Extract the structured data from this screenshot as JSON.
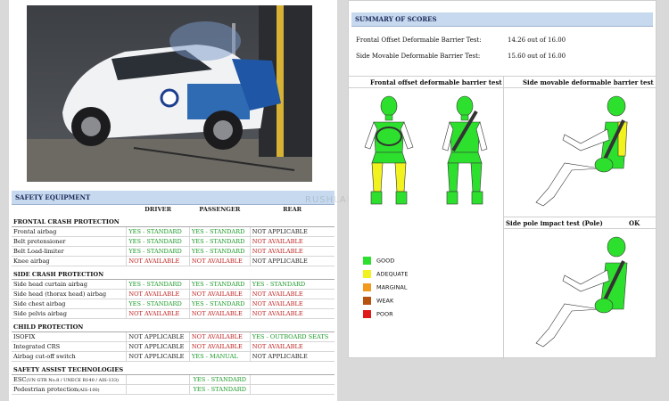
{
  "equipment": {
    "header": "SAFETY EQUIPMENT",
    "columns": [
      "DRIVER",
      "PASSENGER",
      "REAR"
    ],
    "sections": [
      {
        "title": "FRONTAL CRASH PROTECTION",
        "rows": [
          {
            "label": "Frontal airbag",
            "driver": "YES - STANDARD",
            "passenger": "YES - STANDARD",
            "rear": "NOT APPLICABLE"
          },
          {
            "label": "Belt pretensioner",
            "driver": "YES - STANDARD",
            "passenger": "YES - STANDARD",
            "rear": "NOT AVAILABLE"
          },
          {
            "label": "Belt Load-limiter",
            "driver": "YES - STANDARD",
            "passenger": "YES - STANDARD",
            "rear": "NOT AVAILABLE"
          },
          {
            "label": "Knee airbag",
            "driver": "NOT AVAILABLE",
            "passenger": "NOT AVAILABLE",
            "rear": "NOT APPLICABLE"
          }
        ]
      },
      {
        "title": "SIDE CRASH PROTECTION",
        "rows": [
          {
            "label": "Side head curtain airbag",
            "driver": "YES - STANDARD",
            "passenger": "YES - STANDARD",
            "rear": "YES - STANDARD"
          },
          {
            "label": "Side head (thorax head) airbag",
            "driver": "NOT AVAILABLE",
            "passenger": "NOT AVAILABLE",
            "rear": "NOT AVAILABLE"
          },
          {
            "label": "Side chest airbag",
            "driver": "YES - STANDARD",
            "passenger": "YES - STANDARD",
            "rear": "NOT AVAILABLE"
          },
          {
            "label": "Side pelvis airbag",
            "driver": "NOT AVAILABLE",
            "passenger": "NOT AVAILABLE",
            "rear": "NOT AVAILABLE"
          }
        ]
      },
      {
        "title": "CHILD PROTECTION",
        "rows": [
          {
            "label": "ISOFIX",
            "driver": "NOT APPLICABLE",
            "passenger": "NOT AVAILABLE",
            "rear": "YES - OUTBOARD SEATS"
          },
          {
            "label": "Integrated CRS",
            "driver": "NOT APPLICABLE",
            "passenger": "NOT AVAILABLE",
            "rear": "NOT AVAILABLE"
          },
          {
            "label": "Airbag cut-off switch",
            "driver": "NOT APPLICABLE",
            "passenger": "YES - MANUAL",
            "rear": "NOT APPLICABLE"
          }
        ]
      },
      {
        "title": "SAFETY ASSIST TECHNOLOGIES",
        "rows": [
          {
            "label": "ESC",
            "label_small": "(UN GTR No.8 / UNECE R140 / AIS-133)",
            "driver": "",
            "passenger": "YES - STANDARD",
            "rear": ""
          },
          {
            "label": "Pedestrian protection",
            "label_small": "(AIS-100)",
            "driver": "",
            "passenger": "YES - STANDARD",
            "rear": ""
          }
        ]
      }
    ]
  },
  "summary": {
    "header": "SUMMARY OF SCORES",
    "scores": [
      {
        "label": "Frontal Offset Deformable Barrier Test:",
        "value": "14.26 out of 16.00"
      },
      {
        "label": "Side Movable Deformable Barrier Test:",
        "value": "15.60 out of 16.00"
      }
    ]
  },
  "panels": {
    "frontal": "Frontal offset deformable barrier test",
    "side": "Side movable deformable barrier test",
    "pole": "Side pole impact test (Pole)",
    "pole_result": "OK"
  },
  "legend": [
    {
      "label": "GOOD",
      "color": "#2ee02e"
    },
    {
      "label": "ADEQUATE",
      "color": "#f2f21e"
    },
    {
      "label": "MARGINAL",
      "color": "#f29a1e"
    },
    {
      "label": "WEAK",
      "color": "#b8520f"
    },
    {
      "label": "POOR",
      "color": "#e01a1a"
    }
  ],
  "colors": {
    "header_bg": "#c6d9ee",
    "header_text": "#1d2a5a",
    "yes": "#1a9a27",
    "no": "#c02020"
  }
}
